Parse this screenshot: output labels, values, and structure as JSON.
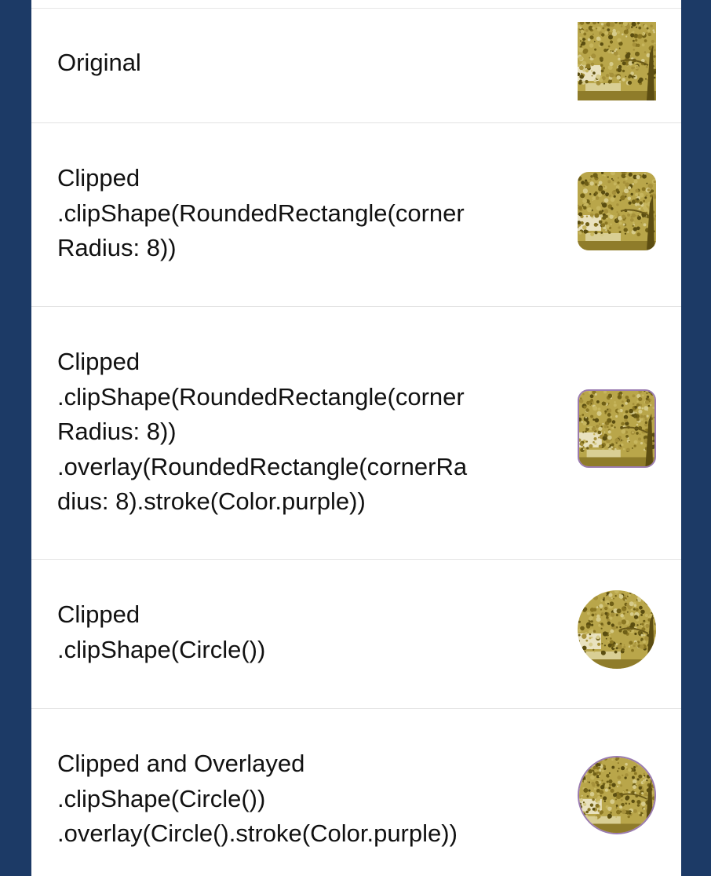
{
  "rows": [
    {
      "lines": [
        "Original"
      ],
      "image": {
        "clip": "none",
        "stroke": false,
        "stroke_color": ""
      }
    },
    {
      "lines": [
        "Clipped",
        ".clipShape(RoundedRectangle(corner",
        "Radius: 8))"
      ],
      "image": {
        "clip": "rounded-rectangle",
        "stroke": false,
        "stroke_color": ""
      }
    },
    {
      "lines": [
        "Clipped",
        ".clipShape(RoundedRectangle(corner",
        "Radius: 8))",
        ".overlay(RoundedRectangle(cornerRa",
        "dius: 8).stroke(Color.purple))"
      ],
      "image": {
        "clip": "rounded-rectangle",
        "stroke": true,
        "stroke_color": "#9a7bb0"
      }
    },
    {
      "lines": [
        "Clipped",
        ".clipShape(Circle())"
      ],
      "image": {
        "clip": "circle",
        "stroke": false,
        "stroke_color": ""
      }
    },
    {
      "lines": [
        "Clipped and Overlayed",
        ".clipShape(Circle())",
        ".overlay(Circle().stroke(Color.purple))"
      ],
      "image": {
        "clip": "circle",
        "stroke": true,
        "stroke_color": "#9a7bb0"
      }
    }
  ],
  "colors": {
    "background": "#1c3a66",
    "list_background": "#ffffff",
    "text": "#111111",
    "separator": "#e3e3e3",
    "image_tint": "#a08a2a"
  }
}
